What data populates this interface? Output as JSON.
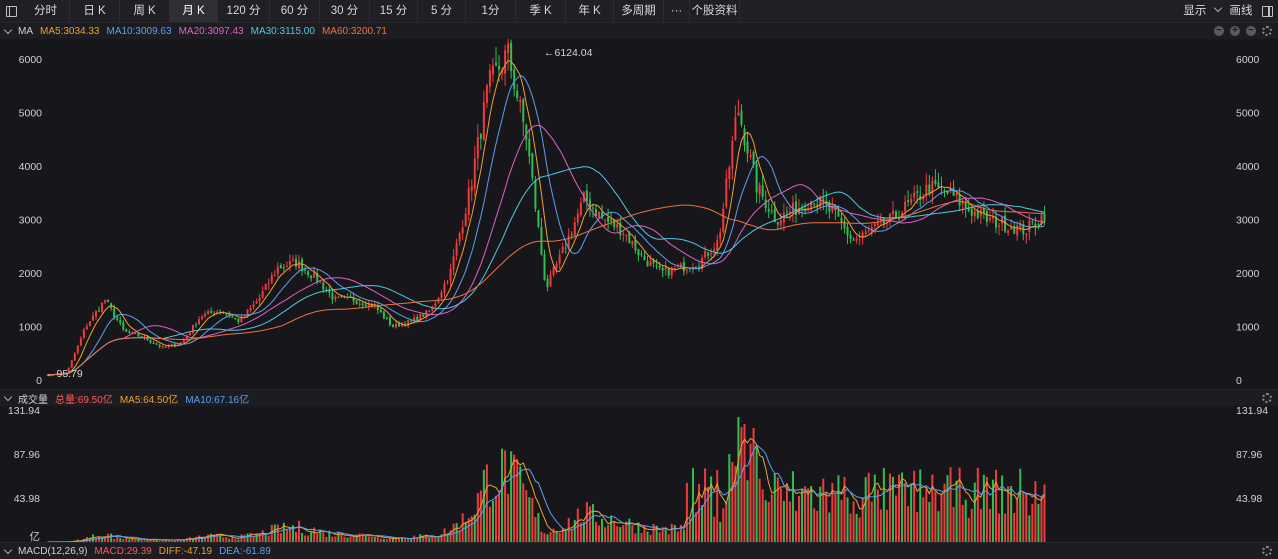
{
  "toolbar": {
    "tabs": [
      {
        "label": "分时"
      },
      {
        "label": "日 K"
      },
      {
        "label": "周 K"
      },
      {
        "label": "月 K",
        "active": true
      },
      {
        "label": "120 分"
      },
      {
        "label": "60 分"
      },
      {
        "label": "30 分"
      },
      {
        "label": "15 分"
      },
      {
        "label": "5 分"
      },
      {
        "label": "1分"
      },
      {
        "label": "季 K"
      },
      {
        "label": "年 K"
      },
      {
        "label": "多周期"
      },
      {
        "label": "···"
      },
      {
        "label": "个股资料"
      }
    ],
    "display_label": "显示",
    "draw_label": "画线"
  },
  "main_indicator": {
    "name": "MA",
    "items": [
      {
        "label": "MA5:3034.33",
        "color": "#f0a032"
      },
      {
        "label": "MA10:3009.63",
        "color": "#5aa0f0"
      },
      {
        "label": "MA20:3097.43",
        "color": "#e060c8"
      },
      {
        "label": "MA30:3115.00",
        "color": "#50c8e0"
      },
      {
        "label": "MA60:3200.71",
        "color": "#f07040"
      }
    ],
    "y_ticks": [
      "6000",
      "5000",
      "4000",
      "3000",
      "2000",
      "1000",
      "0"
    ],
    "high_label": "←6124.04",
    "low_label": "←95.79"
  },
  "volume_indicator": {
    "name": "成交量",
    "items": [
      {
        "label": "总量:69.50亿",
        "color": "#ff5a5a"
      },
      {
        "label": "MA5:64.50亿",
        "color": "#f0a032"
      },
      {
        "label": "MA10:67.16亿",
        "color": "#5aa0f0"
      }
    ],
    "y_ticks": [
      "131.94",
      "87.96",
      "43.98",
      "亿"
    ]
  },
  "macd_indicator": {
    "name": "MACD(12,26,9)",
    "items": [
      {
        "label": "MACD:29.39",
        "color": "#ff5a5a"
      },
      {
        "label": "DIFF:-47.19",
        "color": "#f0a032"
      },
      {
        "label": "DEA:-61.89",
        "color": "#5aa0f0"
      }
    ]
  },
  "colors": {
    "up": "#ee3b3b",
    "down": "#2fbf4f",
    "background": "#17171b"
  },
  "chart_data": {
    "type": "candlestick",
    "period": "monthly",
    "ylim": [
      0,
      6000
    ],
    "anchor_prices": [
      96,
      130,
      1000,
      1500,
      900,
      800,
      600,
      700,
      1200,
      1300,
      1100,
      1500,
      2100,
      2200,
      1900,
      1500,
      1500,
      1400,
      1000,
      1100,
      1300,
      2000,
      3500,
      5500,
      6124,
      4500,
      1700,
      2500,
      3400,
      3000,
      2800,
      2300,
      2000,
      2100,
      2200,
      2600,
      5100,
      3600,
      3000,
      3200,
      3400,
      3100,
      2600,
      2800,
      3000,
      3300,
      3600,
      3500,
      3200,
      3000,
      2900,
      2800,
      3100
    ],
    "volume_ylim": [
      0,
      131.94
    ]
  }
}
